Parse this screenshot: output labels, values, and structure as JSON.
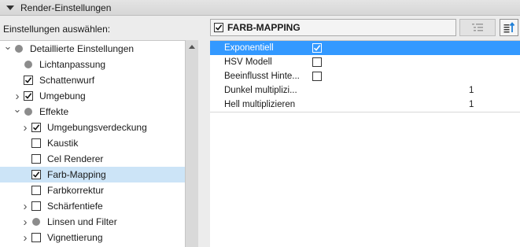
{
  "header": {
    "title": "Render-Einstellungen"
  },
  "left": {
    "label": "Einstellungen auswählen:",
    "tree": [
      {
        "label": "Detaillierte Einstellungen",
        "kind": "dot",
        "expander": "down",
        "level": 0,
        "checked": false,
        "selected": false,
        "name": "tree-item-detaillierte-einstellungen"
      },
      {
        "label": "Lichtanpassung",
        "kind": "dot",
        "expander": "",
        "level": 1,
        "checked": false,
        "selected": false,
        "name": "tree-item-lichtanpassung"
      },
      {
        "label": "Schattenwurf",
        "kind": "checkbox",
        "expander": "",
        "level": 1,
        "checked": true,
        "selected": false,
        "name": "tree-item-schattenwurf"
      },
      {
        "label": "Umgebung",
        "kind": "checkbox",
        "expander": "right",
        "level": 1,
        "checked": true,
        "selected": false,
        "name": "tree-item-umgebung"
      },
      {
        "label": "Effekte",
        "kind": "dot",
        "expander": "down",
        "level": 1,
        "checked": false,
        "selected": false,
        "name": "tree-item-effekte"
      },
      {
        "label": "Umgebungsverdeckung",
        "kind": "checkbox",
        "expander": "right",
        "level": 2,
        "checked": true,
        "selected": false,
        "name": "tree-item-umgebungsverdeckung"
      },
      {
        "label": "Kaustik",
        "kind": "checkbox",
        "expander": "",
        "level": 2,
        "checked": false,
        "selected": false,
        "name": "tree-item-kaustik"
      },
      {
        "label": "Cel Renderer",
        "kind": "checkbox",
        "expander": "",
        "level": 2,
        "checked": false,
        "selected": false,
        "name": "tree-item-cel-renderer"
      },
      {
        "label": "Farb-Mapping",
        "kind": "checkbox",
        "expander": "",
        "level": 2,
        "checked": true,
        "selected": true,
        "name": "tree-item-farb-mapping"
      },
      {
        "label": "Farbkorrektur",
        "kind": "checkbox",
        "expander": "",
        "level": 2,
        "checked": false,
        "selected": false,
        "name": "tree-item-farbkorrektur"
      },
      {
        "label": "Schärfentiefe",
        "kind": "checkbox",
        "expander": "right",
        "level": 2,
        "checked": false,
        "selected": false,
        "name": "tree-item-schaerfentiefe"
      },
      {
        "label": "Linsen und Filter",
        "kind": "dot",
        "expander": "right",
        "level": 2,
        "checked": false,
        "selected": false,
        "name": "tree-item-linsen-und-filter"
      },
      {
        "label": "Vignettierung",
        "kind": "checkbox",
        "expander": "right",
        "level": 2,
        "checked": false,
        "selected": false,
        "name": "tree-item-vignettierung"
      }
    ]
  },
  "right": {
    "title": "FARB-MAPPING",
    "title_checked": true,
    "properties": [
      {
        "name": "Exponentiell",
        "type": "checkbox",
        "checked": true,
        "value": "",
        "selected": true
      },
      {
        "name": "HSV Modell",
        "type": "checkbox",
        "checked": false,
        "value": "",
        "selected": false
      },
      {
        "name": "Beeinflusst Hinte...",
        "type": "checkbox",
        "checked": false,
        "value": "",
        "selected": false
      },
      {
        "name": "Dunkel multiplizi...",
        "type": "number",
        "checked": false,
        "value": "1",
        "selected": false
      },
      {
        "name": "Hell multiplizieren",
        "type": "number",
        "checked": false,
        "value": "1",
        "selected": false
      }
    ]
  },
  "colors": {
    "selection": "#3399ff",
    "tree_selection": "#cce4f7"
  },
  "icons": {
    "list_view": "list-view-icon",
    "sort": "sort-icon"
  }
}
